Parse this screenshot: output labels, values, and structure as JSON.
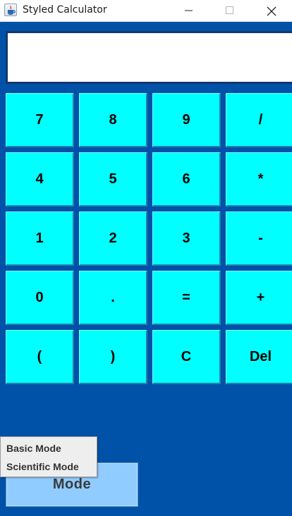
{
  "window": {
    "title": "Styled Calculator",
    "app_icon": "java-cup-icon",
    "controls": [
      "minimize-icon",
      "maximize-icon",
      "close-icon"
    ]
  },
  "display": {
    "value": ""
  },
  "keypad": {
    "rows": [
      [
        "7",
        "8",
        "9",
        "/"
      ],
      [
        "4",
        "5",
        "6",
        "*"
      ],
      [
        "1",
        "2",
        "3",
        "-"
      ],
      [
        "0",
        ".",
        "=",
        "+"
      ],
      [
        "(",
        ")",
        "C",
        "Del"
      ]
    ]
  },
  "mode": {
    "button_label": "Mode",
    "menu": [
      {
        "label": "Basic Mode"
      },
      {
        "label": "Scientific Mode"
      }
    ]
  },
  "colors": {
    "background": "#0052a8",
    "key": "#00ffff",
    "mode_button": "#90ccff",
    "display": "#ffffff"
  }
}
